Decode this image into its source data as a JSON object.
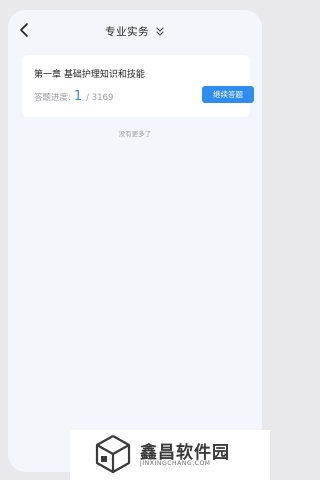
{
  "header": {
    "title": "专业实务",
    "back_icon": "chevron-left-icon",
    "dropdown_icon": "double-chevron-down-icon"
  },
  "card": {
    "chapter_title": "第一章 基础护理知识和技能",
    "progress_label": "答题进度:",
    "progress_current": "1",
    "progress_total": "/ 3169",
    "continue_button": "继续答题"
  },
  "footer": {
    "no_more_text": "没有更多了"
  },
  "watermark": {
    "name": "鑫昌软件园",
    "url": "JINXINGCHANG.COM"
  },
  "colors": {
    "accent": "#2f8cf0",
    "background": "#f5f6fb",
    "card": "#ffffff",
    "muted_text": "#9a9aa0"
  }
}
